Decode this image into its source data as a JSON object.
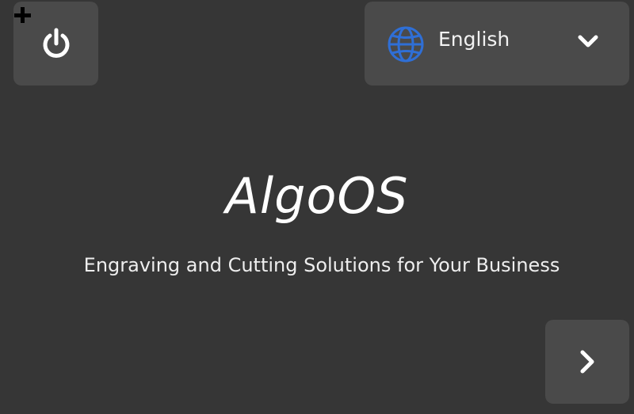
{
  "header": {
    "power_icon": "power-icon",
    "language": {
      "icon": "globe-icon",
      "selected": "English",
      "chevron_icon": "chevron-down-icon"
    }
  },
  "main": {
    "logo_text": "AlgoOS",
    "tagline": "Engraving and Cutting Solutions for Your Business"
  },
  "footer": {
    "next_icon": "chevron-right-icon"
  },
  "colors": {
    "background": "#363636",
    "tile": "#4a4a4a",
    "globe_accent": "#2f6fd6",
    "text": "#ffffff"
  }
}
